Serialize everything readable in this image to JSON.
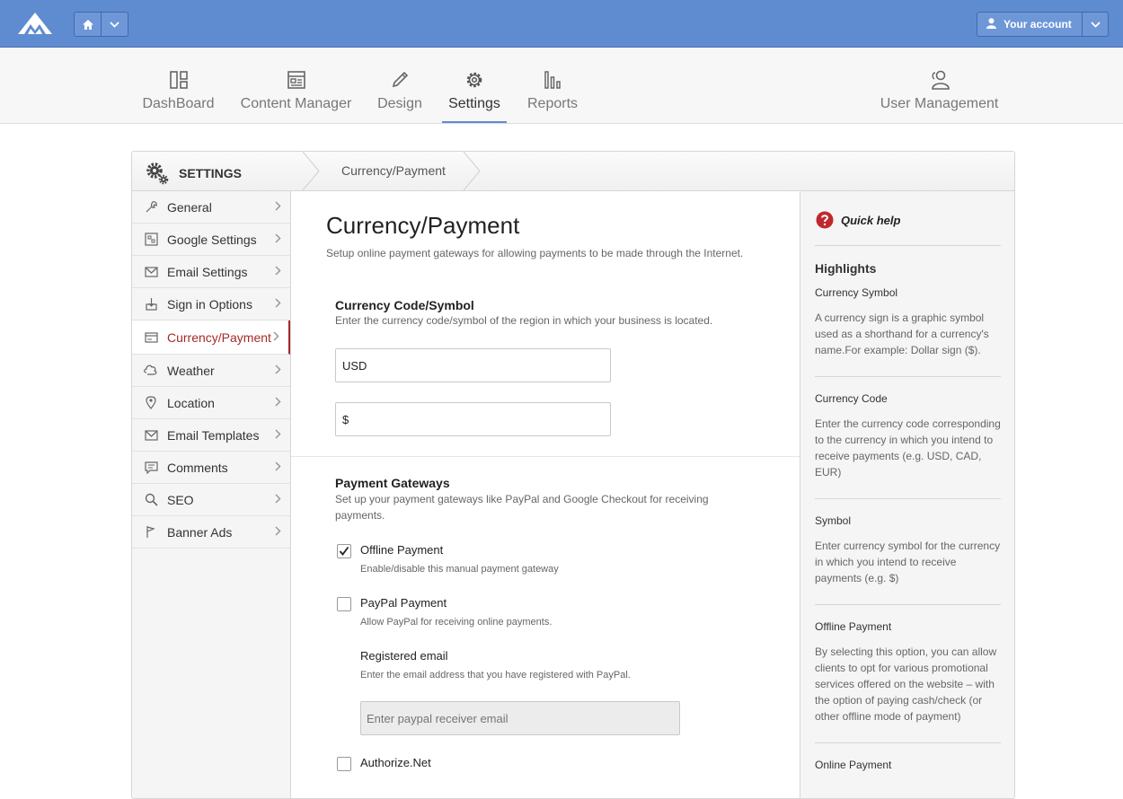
{
  "topbar": {
    "account_label": "Your account",
    "icons": [
      "logo-icon",
      "home-icon",
      "chevron-down-icon",
      "user-icon"
    ]
  },
  "nav": {
    "items": [
      {
        "label": "DashBoard",
        "icon": "dashboard-icon"
      },
      {
        "label": "Content Manager",
        "icon": "content-icon"
      },
      {
        "label": "Design",
        "icon": "pencil-icon"
      },
      {
        "label": "Settings",
        "icon": "gear-icon",
        "active": true
      },
      {
        "label": "Reports",
        "icon": "bar-chart-icon"
      }
    ],
    "user_management": {
      "label": "User Management",
      "icon": "users-icon"
    }
  },
  "breadcrumb": {
    "root": "SETTINGS",
    "current": "Currency/Payment"
  },
  "sidebar": {
    "items": [
      {
        "label": "General",
        "icon": "wrench-icon"
      },
      {
        "label": "Google Settings",
        "icon": "grid-icon"
      },
      {
        "label": "Email Settings",
        "icon": "envelope-icon"
      },
      {
        "label": "Sign in Options",
        "icon": "signin-icon"
      },
      {
        "label": "Currency/Payment",
        "icon": "card-icon",
        "active": true
      },
      {
        "label": "Weather",
        "icon": "cloud-icon"
      },
      {
        "label": "Location",
        "icon": "pin-icon"
      },
      {
        "label": "Email Templates",
        "icon": "envelope-icon"
      },
      {
        "label": "Comments",
        "icon": "comment-icon"
      },
      {
        "label": "SEO",
        "icon": "search-icon"
      },
      {
        "label": "Banner Ads",
        "icon": "flag-icon"
      }
    ]
  },
  "main": {
    "title": "Currency/Payment",
    "description": "Setup online payment gateways for allowing payments to be made through the Internet.",
    "currency": {
      "title": "Currency Code/Symbol",
      "description": "Enter the currency code/symbol of the region in which your business is located.",
      "code_value": "USD",
      "symbol_value": "$"
    },
    "gateways": {
      "title": "Payment Gateways",
      "description": "Set up your payment gateways like PayPal and Google Checkout for receiving payments.",
      "offline": {
        "label": "Offline Payment",
        "description": "Enable/disable this manual payment gateway",
        "checked": true
      },
      "paypal": {
        "label": "PayPal Payment",
        "description": "Allow PayPal for receiving online payments.",
        "checked": false
      },
      "registered_email": {
        "label": "Registered email",
        "description": "Enter the email address that you have registered with PayPal.",
        "placeholder": "Enter paypal receiver email"
      },
      "authorize": {
        "label": "Authorize.Net",
        "checked": false
      }
    }
  },
  "help": {
    "heading": "Quick help",
    "highlights": "Highlights",
    "topics": [
      {
        "title": "Currency Symbol",
        "text": "A currency sign is a graphic symbol used as a shorthand for a currency's name.For example: Dollar sign ($)."
      },
      {
        "title": "Currency Code",
        "text": "Enter the currency code corresponding to the currency in which you intend to receive payments (e.g. USD, CAD, EUR)"
      },
      {
        "title": "Symbol",
        "text": "Enter currency symbol for the currency in which you intend to receive payments (e.g. $)"
      },
      {
        "title": "Offline Payment",
        "text": "By selecting this option, you can allow clients to opt for various promotional services offered on the website – with the option of paying cash/check (or other offline mode of payment)"
      },
      {
        "title": "Online Payment",
        "text": ""
      }
    ]
  },
  "colors": {
    "topbar": "#5f8bd0",
    "active_side": "#a52a2a",
    "help_icon": "#c0282d"
  }
}
